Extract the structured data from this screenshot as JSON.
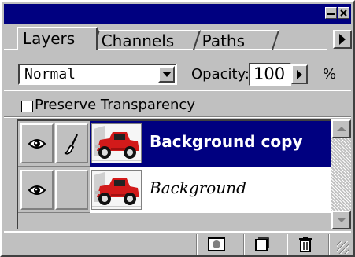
{
  "tabs": [
    {
      "label": "Layers",
      "active": true
    },
    {
      "label": "Channels",
      "active": false
    },
    {
      "label": "Paths",
      "active": false
    }
  ],
  "blend": {
    "mode": "Normal",
    "opacity_label": "Opacity:",
    "opacity_value": "100",
    "percent_sign": "%"
  },
  "preserve_transparency": {
    "label": "Preserve Transparency",
    "checked": false
  },
  "layers": [
    {
      "name": "Background copy",
      "selected": true,
      "visible": true,
      "brush": true
    },
    {
      "name": "Background",
      "selected": false,
      "visible": true,
      "brush": false
    }
  ],
  "colors": {
    "selection": "#000080",
    "face": "#c0c0c0",
    "thumb_car": "#d21a1a"
  },
  "icons": {
    "visibility": "eye-icon",
    "paint": "brush-icon",
    "mask": "layer-mask-icon",
    "new_layer": "new-layer-icon",
    "delete": "trash-icon"
  }
}
